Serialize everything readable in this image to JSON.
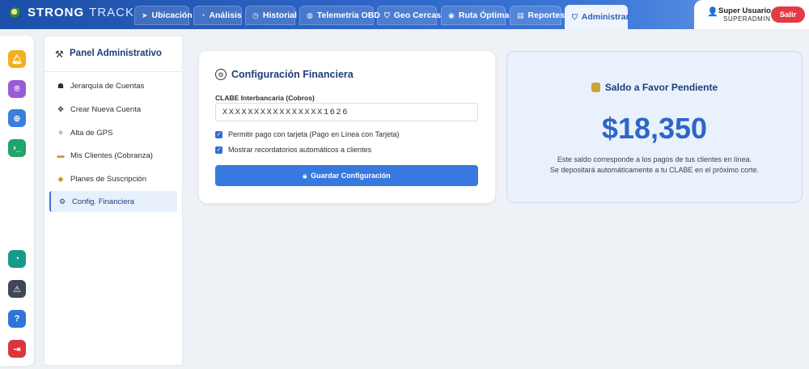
{
  "brand": {
    "strong": "STRONG",
    "track": "TRACK"
  },
  "nav_tabs": [
    {
      "label": "Ubicación",
      "icon": "navigation-arrow-icon"
    },
    {
      "label": "Análisis",
      "icon": "gauge-icon"
    },
    {
      "label": "Historial",
      "icon": "clock-icon"
    },
    {
      "label": "Telemetría OBD",
      "icon": "globe-icon"
    },
    {
      "label": "Geo Cercas",
      "icon": "shield-icon"
    },
    {
      "label": "Ruta Óptima",
      "icon": "route-icon"
    },
    {
      "label": "Reportes",
      "icon": "bar-chart-icon"
    },
    {
      "label": "Administrar",
      "icon": "shield-icon"
    }
  ],
  "user": {
    "name": "Super Usuario",
    "role": "SUPERADMIN",
    "logout_label": "Salir"
  },
  "panel": {
    "title": "Panel Administrativo",
    "items": [
      {
        "label": "Jerarquía de Cuentas",
        "icon": "hierarchy-icon"
      },
      {
        "label": "Crear Nueva Cuenta",
        "icon": "move-icon"
      },
      {
        "label": "Alta de GPS",
        "icon": "sparkle-icon"
      },
      {
        "label": "Mis Clientes (Cobranza)",
        "icon": "card-icon"
      },
      {
        "label": "Planes de Suscripción",
        "icon": "tag-icon"
      },
      {
        "label": "Config. Financiera",
        "icon": "gear-icon"
      }
    ]
  },
  "config": {
    "title": "Configuración Financiera",
    "clabe_label": "CLABE Interbancaria (Cobros)",
    "clabe_value": "XXXXXXXXXXXXXXXX1626",
    "check_card_label": "Permitir pago con tarjeta (Pago en Línea con Tarjeta)",
    "check_reminders_label": "Mostrar recordatorios automáticos a clientes",
    "save_label": "Guardar Configuración"
  },
  "balance": {
    "title": "Saldo a Favor Pendiente",
    "amount": "$18,350",
    "note_line1": "Este saldo corresponde a los pagos de tus clientes en línea.",
    "note_line2": "Se depositará automáticamente a tu CLABE en el próximo corte."
  },
  "colors": {
    "accent": "#2d66c8",
    "danger": "#e53945",
    "rail_yellow": "#f2b01e",
    "rail_purple": "#9a5bd6",
    "rail_blue": "#3a7fe0",
    "rail_green": "#1fa46a",
    "rail_teal": "#159b8a",
    "rail_dark": "#3f4754",
    "rail_help": "#2f74d8",
    "rail_red": "#d9363e"
  }
}
